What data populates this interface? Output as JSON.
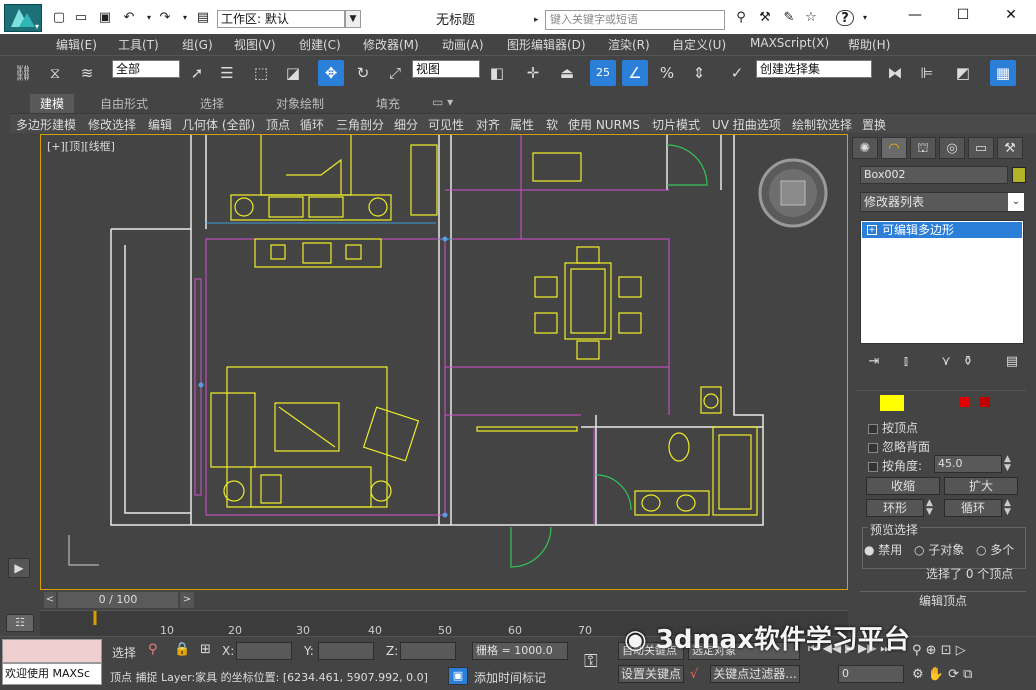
{
  "titlebar": {
    "workspace": "工作区: 默认",
    "window_title": "无标题",
    "search_placeholder": "键入关键字或短语"
  },
  "menu": [
    "编辑(E)",
    "工具(T)",
    "组(G)",
    "视图(V)",
    "创建(C)",
    "修改器(M)",
    "动画(A)",
    "图形编辑器(D)",
    "渲染(R)",
    "自定义(U)",
    "MAXScript(X)",
    "帮助(H)"
  ],
  "toolbar": {
    "selection_filter": "全部",
    "ref_coord": "视图",
    "named_selection": "创建选择集",
    "snap_label": "25",
    "percent_label": "%"
  },
  "ribbon": {
    "tabs": [
      "建模",
      "自由形式",
      "选择",
      "对象绘制",
      "填充"
    ],
    "active_tab": "建模",
    "sub": [
      "多边形建模",
      "修改选择",
      "编辑",
      "几何体 (全部)",
      "顶点",
      "循环",
      "三角剖分",
      "细分",
      "可见性",
      "对齐",
      "属性",
      "软",
      "使用 NURMS",
      "切片模式",
      "UV 扭曲选项",
      "绘制软选择",
      "置换"
    ]
  },
  "viewport": {
    "label": "[+][顶][线框]"
  },
  "command_panel": {
    "object_name": "Box002",
    "object_color": "#b4b42a",
    "modifier_list": "修改器列表",
    "stack_item": "可编辑多边形",
    "by_vertex": "按顶点",
    "ignore_backfacing": "忽略背面",
    "by_angle": "按角度:",
    "angle_value": "45.0",
    "shrink": "收缩",
    "grow": "扩大",
    "ring": "环形",
    "loop": "循环",
    "preview_title": "预览选择",
    "preview_off": "禁用",
    "preview_sub": "子对象",
    "preview_multi": "多个",
    "status": "选择了 0 个顶点",
    "edit_vertices": "编辑顶点"
  },
  "timeline": {
    "frame": "0 / 100",
    "ticks": [
      "10",
      "20",
      "30",
      "40",
      "50",
      "60",
      "70"
    ]
  },
  "status": {
    "welcome": "欢迎使用 MAXSc",
    "select_label": "选择",
    "x_label": "X:",
    "y_label": "Y:",
    "z_label": "Z:",
    "grid": "栅格 = 1000.0",
    "prompt": "顶点 捕捉 Layer:家具 的坐标位置:  [6234.461, 5907.992, 0.0]",
    "add_time_tag": "添加时间标记",
    "auto_key": "自动关键点",
    "selected_object": "选定对象",
    "set_key": "设置关键点",
    "key_filters": "关键点过滤器...",
    "frame_value": "0"
  },
  "watermark": "3dmax软件学习平台"
}
